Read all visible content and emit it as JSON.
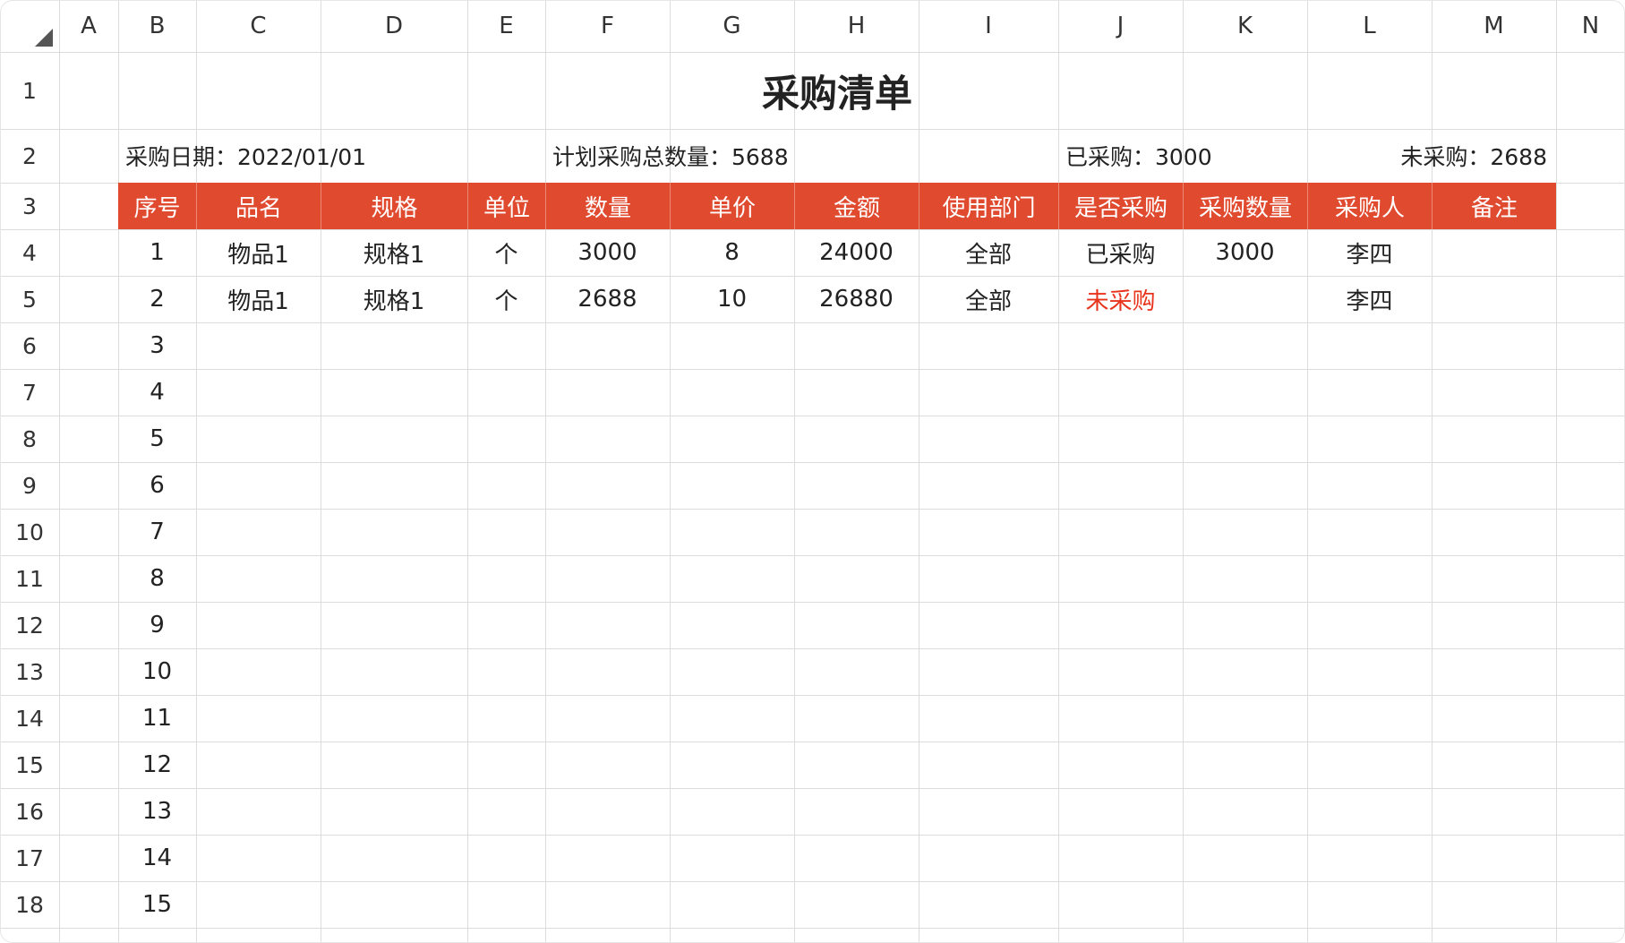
{
  "columns": [
    "A",
    "B",
    "C",
    "D",
    "E",
    "F",
    "G",
    "H",
    "I",
    "J",
    "K",
    "L",
    "M",
    "N"
  ],
  "rows": [
    "1",
    "2",
    "3",
    "4",
    "5",
    "6",
    "7",
    "8",
    "9",
    "10",
    "11",
    "12",
    "13",
    "14",
    "15",
    "16",
    "17",
    "18"
  ],
  "title": "采购清单",
  "info": {
    "date": "采购日期：2022/01/01",
    "planned": "计划采购总数量：5688",
    "purchased": "已采购：3000",
    "unpurchased": "未采购：2688"
  },
  "header": [
    "序号",
    "品名",
    "规格",
    "单位",
    "数量",
    "单价",
    "金额",
    "使用部门",
    "是否采购",
    "采购数量",
    "采购人",
    "备注"
  ],
  "records": [
    [
      "1",
      "物品1",
      "规格1",
      "个",
      "3000",
      "8",
      "24000",
      "全部",
      "已采购",
      "3000",
      "李四",
      ""
    ],
    [
      "2",
      "物品1",
      "规格1",
      "个",
      "2688",
      "10",
      "26880",
      "全部",
      "未采购",
      "",
      "李四",
      ""
    ]
  ],
  "serials": [
    "3",
    "4",
    "5",
    "6",
    "7",
    "8",
    "9",
    "10",
    "11",
    "12",
    "13",
    "14",
    "15"
  ],
  "colors": {
    "header_bg": "#e04a2f",
    "not_purchased": "#e8341c"
  }
}
